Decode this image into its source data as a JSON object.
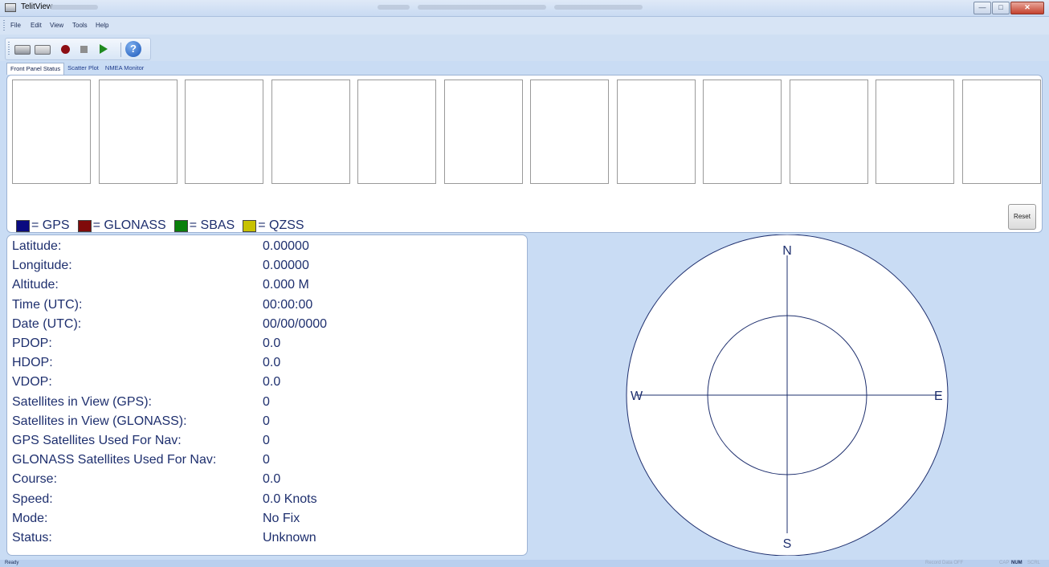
{
  "window": {
    "title": "TelitView"
  },
  "menu": [
    "File",
    "Edit",
    "View",
    "Tools",
    "Help"
  ],
  "toolbar": {
    "icons": [
      "device-connect-icon",
      "device-disconnect-icon",
      "record-icon",
      "stop-icon",
      "play-icon",
      "help-icon"
    ]
  },
  "tabs": [
    "Front Panel Status",
    "Scatter Plot",
    "NMEA Monitor"
  ],
  "signal_panel": {
    "slots": 12,
    "legend": [
      {
        "label": "= GPS",
        "color": "#0a0a80"
      },
      {
        "label": "= GLONASS",
        "color": "#800a0a"
      },
      {
        "label": "= SBAS",
        "color": "#0a800a"
      },
      {
        "label": "= QZSS",
        "color": "#c8c200"
      }
    ],
    "reset_label": "Reset"
  },
  "info": [
    {
      "label": "Latitude:",
      "value": "0.00000"
    },
    {
      "label": "Longitude:",
      "value": "0.00000"
    },
    {
      "label": "Altitude:",
      "value": "0.000 M"
    },
    {
      "label": "Time (UTC):",
      "value": "00:00:00"
    },
    {
      "label": "Date (UTC):",
      "value": "00/00/0000"
    },
    {
      "label": "PDOP:",
      "value": "0.0"
    },
    {
      "label": "HDOP:",
      "value": "0.0"
    },
    {
      "label": "VDOP:",
      "value": "0.0"
    },
    {
      "label": "Satellites in View (GPS):",
      "value": "0"
    },
    {
      "label": "Satellites in View (GLONASS):",
      "value": "0"
    },
    {
      "label": "GPS Satellites Used For Nav:",
      "value": "0"
    },
    {
      "label": "GLONASS Satellites Used For Nav:",
      "value": "0"
    },
    {
      "label": "Course:",
      "value": "0.0"
    },
    {
      "label": "Speed:",
      "value": "0.0 Knots"
    },
    {
      "label": "Mode:",
      "value": "No Fix"
    },
    {
      "label": "Status:",
      "value": "Unknown"
    }
  ],
  "sky": {
    "north": "N",
    "south": "S",
    "east": "E",
    "west": "W"
  },
  "status": {
    "ready": "Ready",
    "record": "Record Data OFF",
    "cap": "CAP",
    "num": "NUM",
    "scrl": "SCRL"
  }
}
